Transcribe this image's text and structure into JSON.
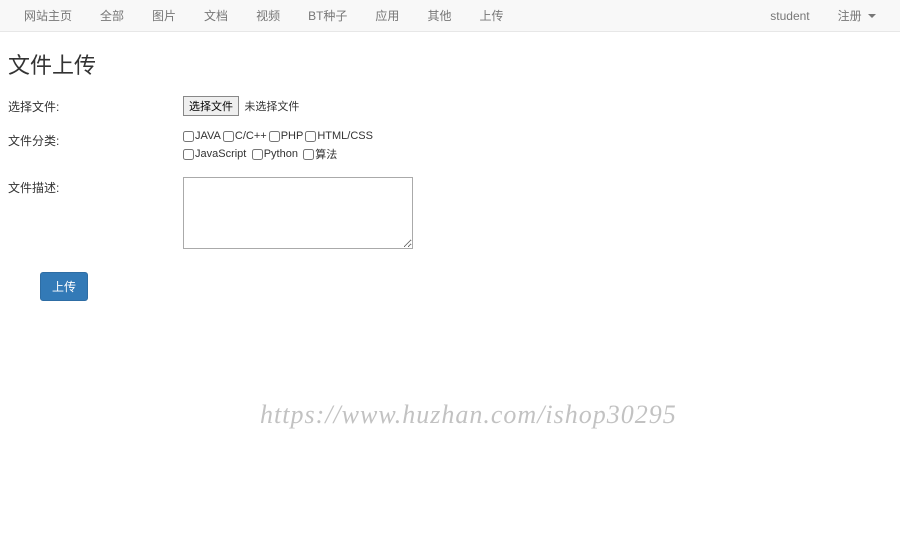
{
  "nav": {
    "left": [
      "网站主页",
      "全部",
      "图片",
      "文档",
      "视频",
      "BT种子",
      "应用",
      "其他",
      "上传"
    ],
    "right_user": "student",
    "right_register": "注册"
  },
  "page": {
    "title": "文件上传"
  },
  "form": {
    "file_label": "选择文件:",
    "file_button": "选择文件",
    "file_status": "未选择文件",
    "category_label": "文件分类:",
    "categories_row1": [
      "JAVA",
      "C/C++",
      "PHP",
      "HTML/CSS"
    ],
    "categories_row2": [
      "JavaScript",
      "Python",
      "算法"
    ],
    "desc_label": "文件描述:",
    "desc_value": "",
    "submit": "上传"
  },
  "watermark": "https://www.huzhan.com/ishop30295"
}
